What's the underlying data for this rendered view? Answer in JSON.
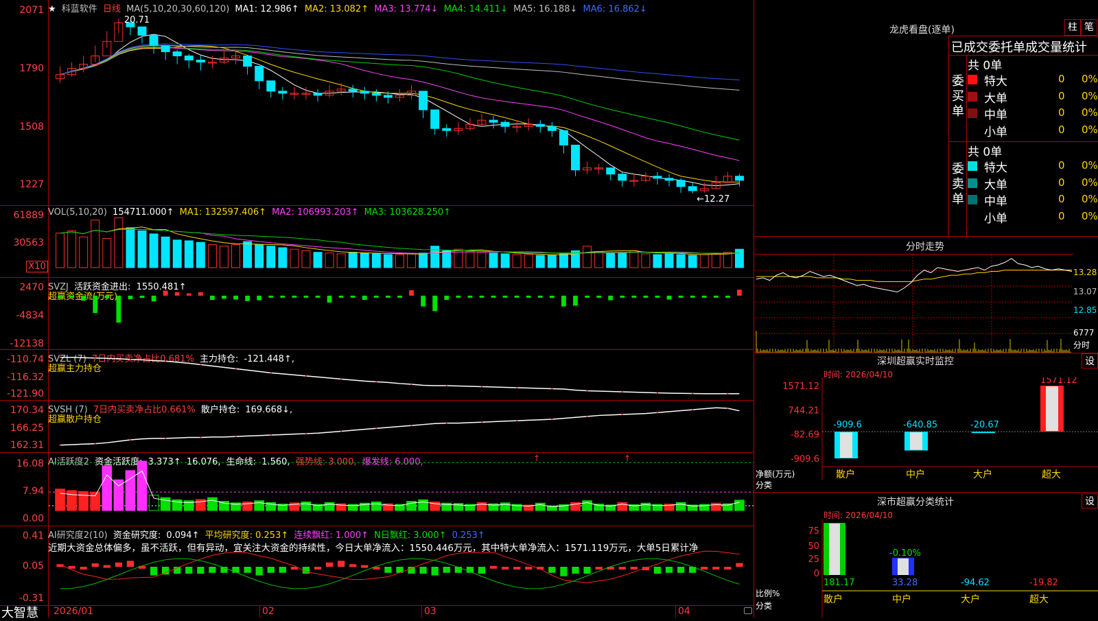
{
  "stock": {
    "star": "★",
    "name": "科蓝软件",
    "period": "日线"
  },
  "kline": {
    "ma_header": "MA(5,10,20,30,60,120)",
    "ma1": "MA1: 12.986↑",
    "ma2": "MA2: 13.082↑",
    "ma3": "MA3: 13.774↓",
    "ma4": "MA4: 14.411↓",
    "ma5": "MA5: 16.188↓",
    "ma6": "MA6: 16.862↓",
    "y_labels": [
      "2071",
      "1790",
      "1508",
      "1227"
    ],
    "high_mark": "20.71",
    "low_mark": "←12.27",
    "closes": [
      18.0,
      18.3,
      18.5,
      18.9,
      19.6,
      20.5,
      20.3,
      19.9,
      19.4,
      19.1,
      18.9,
      18.7,
      18.6,
      18.6,
      18.8,
      18.9,
      18.4,
      17.7,
      17.2,
      17.1,
      17.1,
      17.1,
      17.0,
      17.2,
      17.3,
      17.2,
      17.1,
      17.0,
      16.9,
      17.0,
      17.2,
      16.3,
      15.4,
      15.3,
      15.4,
      15.6,
      15.8,
      15.7,
      15.5,
      15.5,
      15.6,
      15.5,
      15.3,
      14.6,
      13.4,
      13.5,
      13.5,
      13.2,
      12.9,
      12.9,
      13.1,
      13.0,
      12.9,
      12.6,
      12.4,
      12.5,
      12.8,
      13.1,
      12.9
    ],
    "highs": [
      18.4,
      18.6,
      18.9,
      19.4,
      20.1,
      20.71,
      20.6,
      20.2,
      19.8,
      19.4,
      19.2,
      19.0,
      18.9,
      18.9,
      19.1,
      19.2,
      18.8,
      18.1,
      17.6,
      17.4,
      17.4,
      17.4,
      17.3,
      17.5,
      17.6,
      17.5,
      17.4,
      17.3,
      17.2,
      17.3,
      17.5,
      16.8,
      15.9,
      15.6,
      15.7,
      15.9,
      16.1,
      16.0,
      15.8,
      15.8,
      15.9,
      15.8,
      15.7,
      15.2,
      14.3,
      13.8,
      13.7,
      13.5,
      13.3,
      13.2,
      13.3,
      13.3,
      13.2,
      13.0,
      12.8,
      12.8,
      13.1,
      13.3,
      13.2
    ],
    "lows": [
      17.6,
      17.9,
      18.1,
      18.6,
      19.3,
      20.0,
      19.9,
      19.5,
      19.0,
      18.7,
      18.5,
      18.3,
      18.2,
      18.3,
      18.5,
      18.5,
      18.0,
      17.3,
      16.9,
      16.8,
      16.8,
      16.8,
      16.7,
      16.9,
      17.0,
      16.9,
      16.8,
      16.7,
      16.6,
      16.7,
      16.8,
      15.9,
      15.1,
      15.0,
      15.1,
      15.3,
      15.5,
      15.4,
      15.2,
      15.2,
      15.3,
      15.2,
      15.0,
      14.2,
      13.1,
      13.2,
      13.2,
      12.9,
      12.6,
      12.6,
      12.8,
      12.7,
      12.6,
      12.3,
      12.27,
      12.3,
      12.5,
      12.8,
      12.6
    ]
  },
  "vol": {
    "header": "VOL(5,10,20)",
    "value": "154711.000↑",
    "ma1": "MA1: 132597.406↑",
    "ma2": "MA2: 106993.203↑",
    "ma3": "MA3: 103628.250↑",
    "y_labels": [
      "61889",
      "30563"
    ],
    "unit": "X10",
    "values": [
      45,
      48,
      40,
      62,
      38,
      65,
      52,
      48,
      44,
      40,
      36,
      35,
      33,
      30,
      28,
      30,
      34,
      30,
      28,
      26,
      24,
      22,
      20,
      19,
      18,
      20,
      19,
      18,
      17,
      17,
      18,
      19,
      28,
      22,
      24,
      21,
      20,
      19,
      18,
      17,
      17,
      16,
      16,
      18,
      22,
      28,
      21,
      19,
      20,
      22,
      18,
      17,
      18,
      17,
      16,
      17,
      19,
      20,
      24
    ]
  },
  "svzj": {
    "header": "SVZJ",
    "title": "活跃资金进出:",
    "value": "1550.481↑",
    "subtitle": "超赢资金流(万元)",
    "y_labels": [
      "2470",
      "-4834",
      "-12138"
    ],
    "values": [
      -700,
      -400,
      -1300,
      -4500,
      -700,
      -7000,
      -900,
      -600,
      -1500,
      1300,
      900,
      600,
      900,
      -1100,
      -800,
      -1000,
      -1400,
      -1200,
      -300,
      -200,
      -200,
      -300,
      -200,
      -1800,
      -400,
      -400,
      -1100,
      -300,
      -300,
      -300,
      1400,
      -2800,
      -4000,
      -1100,
      -300,
      -300,
      -300,
      -300,
      -300,
      -300,
      -300,
      -300,
      -600,
      -2800,
      -2600,
      -300,
      -300,
      -1200,
      -400,
      -300,
      -300,
      -300,
      -1000,
      -300,
      -300,
      -300,
      -300,
      -300,
      1550
    ]
  },
  "svzl": {
    "header": "SVZL (7)",
    "ratio": "7日内买卖净占比0.681%",
    "label": "主力持仓:",
    "value": "-121.448↑,",
    "subtitle": "超赢主力持仓",
    "y_labels": [
      "-110.74",
      "-116.32",
      "-121.90"
    ],
    "values": [
      -110.9,
      -110.9,
      -111.0,
      -111.1,
      -111.2,
      -111.3,
      -111.5,
      -111.6,
      -111.8,
      -112.0,
      -112.3,
      -112.6,
      -113.0,
      -113.4,
      -113.8,
      -114.2,
      -114.6,
      -115.0,
      -115.4,
      -115.7,
      -116.0,
      -116.3,
      -116.6,
      -116.9,
      -117.2,
      -117.5,
      -117.8,
      -118.0,
      -118.2,
      -118.5,
      -118.7,
      -119.0,
      -119.1,
      -119.1,
      -119.2,
      -119.3,
      -119.4,
      -119.5,
      -119.6,
      -119.7,
      -119.8,
      -119.9,
      -120.0,
      -120.1,
      -120.4,
      -120.6,
      -120.7,
      -120.8,
      -120.9,
      -121.0,
      -121.1,
      -121.2,
      -121.3,
      -121.35,
      -121.4,
      -121.45,
      -121.45,
      -121.45,
      -121.448
    ]
  },
  "svsh": {
    "header": "SVSH (7)",
    "ratio": "7日内买卖净占比0.661%",
    "label": "散户持仓:",
    "value": "169.668↓,",
    "subtitle": "超赢散户持仓",
    "y_labels": [
      "170.34",
      "166.25",
      "162.31"
    ],
    "values": [
      162.5,
      162.6,
      162.7,
      162.8,
      163.0,
      163.3,
      163.6,
      163.8,
      163.9,
      163.9,
      164.0,
      164.1,
      164.1,
      164.2,
      164.2,
      164.3,
      164.4,
      164.5,
      164.6,
      164.7,
      164.8,
      164.9,
      165.0,
      165.2,
      165.4,
      165.6,
      165.8,
      166.0,
      166.2,
      166.4,
      166.6,
      166.8,
      167.0,
      167.1,
      167.1,
      167.2,
      167.3,
      167.4,
      167.5,
      167.6,
      167.7,
      167.8,
      167.9,
      168.1,
      168.3,
      168.5,
      168.7,
      168.8,
      168.9,
      169.0,
      169.1,
      169.3,
      169.5,
      169.7,
      169.9,
      170.1,
      170.3,
      170.2,
      169.668
    ]
  },
  "ai_active": {
    "header": "AI活跃度2",
    "label": "资金活跃度:",
    "value": "3.373↑",
    "v2": "16.076,",
    "life_label": "生命线:",
    "life_value": "1.560,",
    "strong": "强势线: 3.000,",
    "burst": "爆发线: 6.000,",
    "y_labels": [
      "16.08",
      "7.94",
      "0.00"
    ],
    "values": [
      7.0,
      6.5,
      6.2,
      6.0,
      14.5,
      10.0,
      13.0,
      16.08,
      5.0,
      4.2,
      3.5,
      3.2,
      3.6,
      4.2,
      3.0,
      2.5,
      2.8,
      3.2,
      2.6,
      2.1,
      2.5,
      2.8,
      2.0,
      2.6,
      2.2,
      2.0,
      2.4,
      2.8,
      2.2,
      2.0,
      3.0,
      3.5,
      2.8,
      2.4,
      2.3,
      2.0,
      2.6,
      2.2,
      2.5,
      2.0,
      1.8,
      2.4,
      1.5,
      1.9,
      2.6,
      3.2,
      2.1,
      1.8,
      2.6,
      1.9,
      2.4,
      2.0,
      2.1,
      2.6,
      1.8,
      2.0,
      2.4,
      2.2,
      3.373
    ]
  },
  "ai_research": {
    "header": "AI研究度2(10)",
    "label": "资金研究度:",
    "value": "0.094↑",
    "avg": "平均研究度: 0.253↑",
    "streak": "连续飘红: 1.000↑",
    "nday": "N日飘红: 3.000↑",
    "extra": "0.253↑",
    "y_labels": [
      "0.41",
      "0.05",
      "-0.31"
    ],
    "comment": "近期大资金总体偏多，虽不活跃，但有异动，宜关注大资金的持续性，今日大单净流入：1550.446万元，其中特大单净流入：1571.119万元，大单5日累计净",
    "values": [
      0.08,
      0.06,
      0.05,
      0.09,
      0.07,
      0.1,
      0.12,
      0.06,
      -0.05,
      -0.04,
      -0.03,
      -0.03,
      -0.03,
      -0.02,
      -0.02,
      -0.02,
      -0.02,
      -0.05,
      -0.02,
      -0.02,
      0.02,
      -0.03,
      0.05,
      0.1,
      0.12,
      0.08,
      0.07,
      0.05,
      -0.02,
      -0.02,
      -0.03,
      -0.03,
      -0.05,
      -0.02,
      -0.02,
      -0.02,
      -0.03,
      0.06,
      0.02,
      0.03,
      0.04,
      0.05,
      -0.02,
      -0.06,
      -0.03,
      -0.03,
      0.02,
      0.02,
      0.03,
      0.02,
      0.01,
      -0.03,
      -0.02,
      -0.02,
      -0.02,
      0.02,
      0.03,
      0.04,
      0.094
    ]
  },
  "timeline": {
    "labels": [
      "2026/01",
      "02",
      "03",
      "04"
    ]
  },
  "footer": {
    "brand": "大智慧"
  },
  "dragon": {
    "title": "龙虎看盘(逐单)",
    "btn1": "柱",
    "btn2": "笔",
    "stat_title": "已成交委托单成交量统计",
    "buy_side": "委买单",
    "sell_side": "委卖单",
    "buy_total": "共 0单",
    "sell_total": "共 0单",
    "buy_rows": [
      {
        "label": "特大",
        "count": "0",
        "pct": "0%",
        "color": "#ff1010"
      },
      {
        "label": "大单",
        "count": "0",
        "pct": "0%",
        "color": "#a01010"
      },
      {
        "label": "中单",
        "count": "0",
        "pct": "0%",
        "color": "#801010"
      },
      {
        "label": "小单",
        "count": "0",
        "pct": "0%",
        "color": ""
      }
    ],
    "sell_rows": [
      {
        "label": "特大",
        "count": "0",
        "pct": "0%",
        "color": "#00e0e0"
      },
      {
        "label": "大单",
        "count": "0",
        "pct": "0%",
        "color": "#009090"
      },
      {
        "label": "中单",
        "count": "0",
        "pct": "0%",
        "color": "#007070"
      },
      {
        "label": "小单",
        "count": "0",
        "pct": "0%",
        "color": ""
      }
    ]
  },
  "intraday": {
    "title": "分时走势",
    "y_labels": [
      "13.28",
      "13.07",
      "12.85"
    ],
    "vol_label": "6777",
    "vol_unit": "分时",
    "prices": [
      13.15,
      13.16,
      13.14,
      13.18,
      13.2,
      13.17,
      13.16,
      13.18,
      13.21,
      13.19,
      13.17,
      13.18,
      13.16,
      13.14,
      13.12,
      13.1,
      13.11,
      13.09,
      13.08,
      13.07,
      13.06,
      13.05,
      13.08,
      13.12,
      13.18,
      13.22,
      13.2,
      13.24,
      13.23,
      13.22,
      13.21,
      13.22,
      13.23,
      13.24,
      13.22,
      13.25,
      13.26,
      13.28,
      13.31,
      13.27,
      13.26,
      13.24,
      13.25,
      13.23,
      13.22,
      13.23,
      13.22,
      13.21
    ],
    "avg": [
      13.17,
      13.17,
      13.17,
      13.17,
      13.17,
      13.17,
      13.17,
      13.17,
      13.17,
      13.16,
      13.16,
      13.16,
      13.16,
      13.15,
      13.15,
      13.14,
      13.14,
      13.14,
      13.13,
      13.13,
      13.13,
      13.13,
      13.13,
      13.13,
      13.14,
      13.15,
      13.15,
      13.16,
      13.17,
      13.18,
      13.18,
      13.19,
      13.19,
      13.2,
      13.2,
      13.21,
      13.21,
      13.22,
      13.22,
      13.22,
      13.22,
      13.22,
      13.22,
      13.22,
      13.22,
      13.22,
      13.22,
      13.22
    ]
  },
  "realtime": {
    "title": "深圳超赢实时监控",
    "btn": "设",
    "date": "时间: 2026/04/10",
    "y_labels": [
      "1571.12",
      "744.21",
      "-82.69",
      "-909.6"
    ],
    "unit": "净额(万元)",
    "cat_title": "分类",
    "cats": [
      {
        "label": "散户",
        "value": "-909.6",
        "num": -909.6
      },
      {
        "label": "中户",
        "value": "-640.85",
        "num": -640.85
      },
      {
        "label": "大户",
        "value": "-20.67",
        "num": -20.67
      },
      {
        "label": "超大",
        "value": "1571.12",
        "num": 1571.12
      }
    ]
  },
  "classify": {
    "title": "深市超赢分类统计",
    "btn": "设",
    "date": "时间: 2026/04/10",
    "y_labels": [
      "75",
      "50",
      "25",
      "0"
    ],
    "mid_label": "-0.10%",
    "unit": "比例%",
    "cat_title": "分类",
    "cats": [
      {
        "label": "散户",
        "value": "181.17",
        "num": 100
      },
      {
        "label": "中户",
        "value": "33.28",
        "num": 33.28
      },
      {
        "label": "大户",
        "value": "-94.62",
        "num": -94.62
      },
      {
        "label": "超大",
        "value": "-19.82",
        "num": -19.82
      }
    ]
  },
  "colors": {
    "up": "#ff2d2d",
    "down": "#00e5ff",
    "border": "#b00000",
    "ma1": "#ffffff",
    "ma2": "#ffd800",
    "ma3": "#ff40ff",
    "ma4": "#00d000",
    "ma5": "#c0c0c0",
    "ma6": "#3050ff"
  }
}
